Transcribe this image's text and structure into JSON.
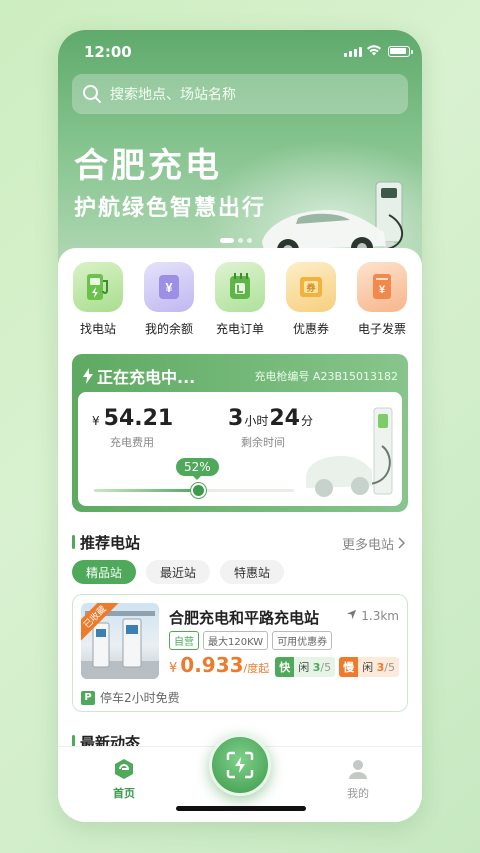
{
  "status": {
    "time": "12:00"
  },
  "search": {
    "placeholder": "搜索地点、场站名称"
  },
  "hero": {
    "title": "合肥充电",
    "subtitle": "护航绿色智慧出行"
  },
  "functions": [
    {
      "label": "找电站",
      "icon": "charging-station-icon"
    },
    {
      "label": "我的余额",
      "icon": "wallet-icon"
    },
    {
      "label": "充电订单",
      "icon": "order-icon"
    },
    {
      "label": "优惠券",
      "icon": "coupon-icon"
    },
    {
      "label": "电子发票",
      "icon": "invoice-icon"
    }
  ],
  "charging": {
    "title": "正在充电中...",
    "gun": "充电枪编号 A23B15013182",
    "currency": "¥",
    "fee": "54.21",
    "fee_label": "充电费用",
    "hours": "3",
    "hours_unit": "小时",
    "minutes": "24",
    "minutes_unit": "分",
    "remaining_label": "剩余时间",
    "percent": "52%",
    "progress": 0.52
  },
  "recommend": {
    "title": "推荐电站",
    "more": "更多电站",
    "tabs": [
      "精品站",
      "最近站",
      "特惠站"
    ]
  },
  "station": {
    "tag": "已收藏",
    "name": "合肥充电和平路充电站",
    "distance": "1.3km",
    "badges": [
      "自营",
      "最大120KW",
      "可用优惠券"
    ],
    "currency": "¥",
    "price": "0.933",
    "unit": "/度起",
    "fast_label": "快",
    "fast_free": "闲",
    "fast_count": "3",
    "fast_total": "/5",
    "slow_label": "慢",
    "slow_free": "闲",
    "slow_count": "3",
    "slow_total": "/5",
    "parking_icon": "P",
    "parking": "停车2小时免费"
  },
  "news": {
    "title": "最新动态"
  },
  "nav": {
    "home": "首页",
    "mine": "我的"
  },
  "colors": {
    "primary": "#4ea95a",
    "accent": "#f07a2c"
  }
}
